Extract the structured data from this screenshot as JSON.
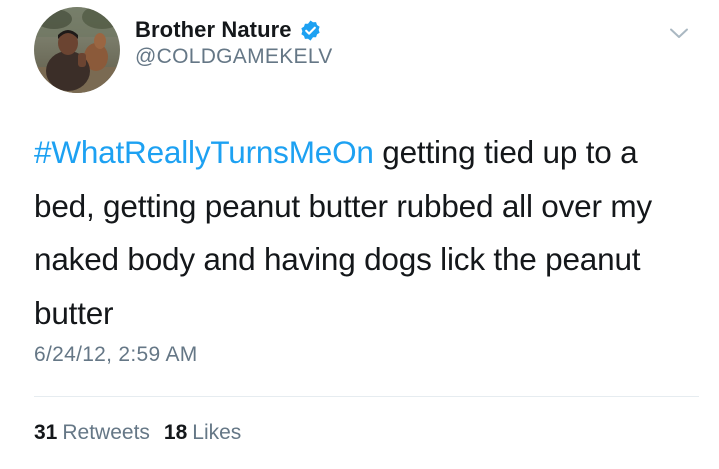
{
  "user": {
    "display_name": "Brother Nature",
    "handle": "@COLDGAMEKELV",
    "verified": true
  },
  "tweet": {
    "hashtag": "#WhatReallyTurnsMeOn",
    "body": " getting tied up to a bed, getting peanut butter rubbed all over my naked body and having dogs lick the peanut butter",
    "timestamp": "6/24/12, 2:59 AM"
  },
  "stats": {
    "retweets_count": "31",
    "retweets_label": "Retweets",
    "likes_count": "18",
    "likes_label": "Likes"
  },
  "icons": {
    "verified": "verified-badge-icon",
    "menu": "chevron-down-icon"
  },
  "colors": {
    "accent": "#1da1f2",
    "text": "#14171a",
    "secondary": "#657786",
    "divider": "#e6ecf0"
  }
}
